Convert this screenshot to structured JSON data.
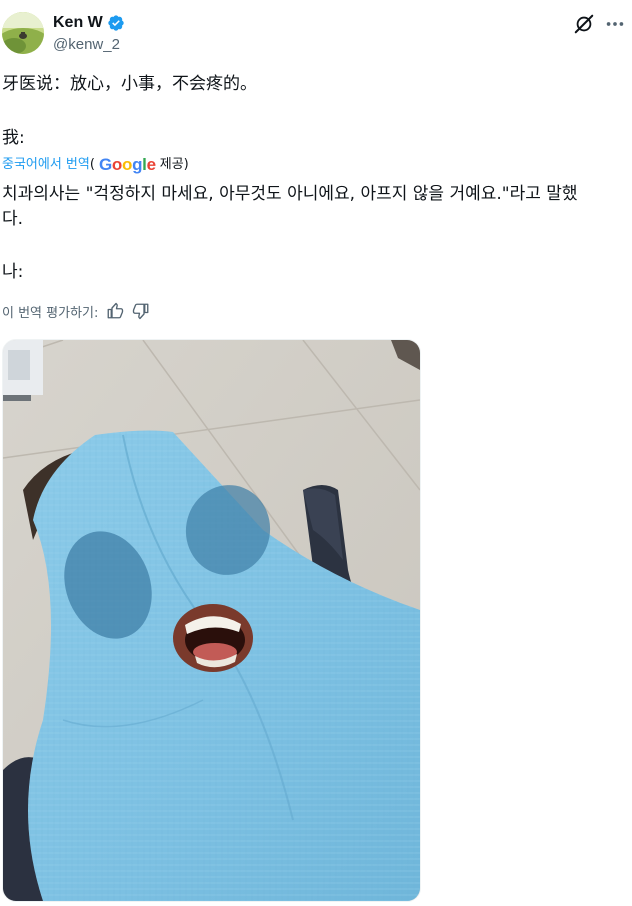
{
  "author": {
    "name": "Ken W",
    "handle": "@kenw_2",
    "verified": true,
    "avatar_icon": "avatar-landscape-icon"
  },
  "actions": {
    "grok_icon": "grok-slash-icon",
    "more_icon": "more-dots-icon"
  },
  "tweet": {
    "original_line1": "牙医说：放心，小事，不会疼的。",
    "original_line2": "我:",
    "translated_from": "중국어에서 번역",
    "translated_paren_open": "(",
    "translated_by": "Google",
    "translated_provided": "제공)",
    "translated_line1": "치과의사는 \"걱정하지 마세요, 아무것도 아니에요, 아프지 않을 거예요.\"라고 말했",
    "translated_line2": "다.",
    "translated_line3": "나:"
  },
  "rating": {
    "label": "이 번역 평가하기:",
    "thumbs_up_icon": "thumbs-up-icon",
    "thumbs_down_icon": "thumbs-down-icon"
  },
  "media": {
    "kind": "photo",
    "icon": "photo-of-patient-under-dental-bib"
  },
  "colors": {
    "text": "#0f1419",
    "secondary": "#536471",
    "link": "#1d9bf0",
    "verified": "#1d9bf0",
    "bib_blue": "#7fc4e6"
  }
}
